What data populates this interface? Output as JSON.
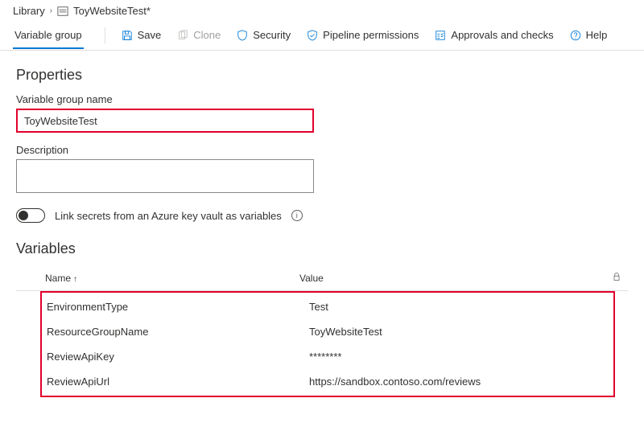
{
  "breadcrumb": {
    "root": "Library",
    "current": "ToyWebsiteTest*"
  },
  "toolbar": {
    "tab": "Variable group",
    "save": "Save",
    "clone": "Clone",
    "security": "Security",
    "permissions": "Pipeline permissions",
    "approvals": "Approvals and checks",
    "help": "Help"
  },
  "properties": {
    "heading": "Properties",
    "name_label": "Variable group name",
    "name_value": "ToyWebsiteTest",
    "desc_label": "Description",
    "desc_value": "",
    "kv_label": "Link secrets from an Azure key vault as variables"
  },
  "variables": {
    "heading": "Variables",
    "name_header": "Name",
    "value_header": "Value",
    "rows": [
      {
        "name": "EnvironmentType",
        "value": "Test"
      },
      {
        "name": "ResourceGroupName",
        "value": "ToyWebsiteTest"
      },
      {
        "name": "ReviewApiKey",
        "value": "********"
      },
      {
        "name": "ReviewApiUrl",
        "value": "https://sandbox.contoso.com/reviews"
      }
    ]
  }
}
